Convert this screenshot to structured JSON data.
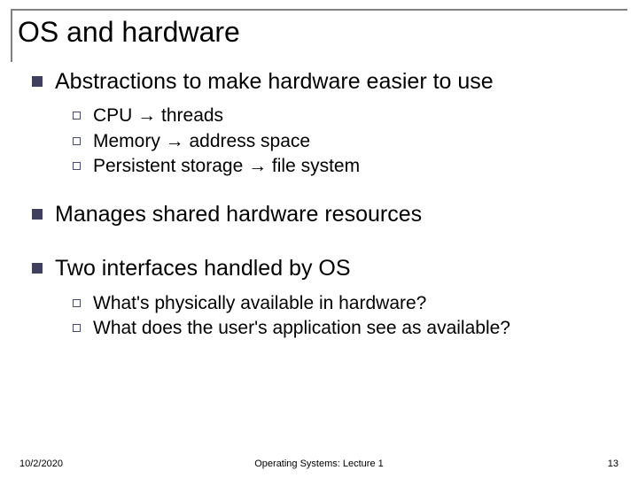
{
  "title": "OS and hardware",
  "bullets": [
    {
      "text": "Abstractions to make hardware easier to use",
      "sub": [
        "CPU → threads",
        "Memory → address space",
        "Persistent storage → file system"
      ]
    },
    {
      "text": "Manages shared hardware resources",
      "sub": []
    },
    {
      "text": "Two interfaces handled by OS",
      "sub": [
        "What's physically available in hardware?",
        "What does the user's application see as available?"
      ]
    }
  ],
  "footer": {
    "date": "10/2/2020",
    "center": "Operating Systems: Lecture 1",
    "page": "13"
  }
}
